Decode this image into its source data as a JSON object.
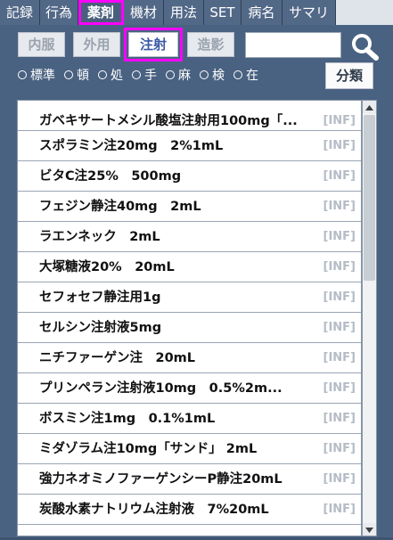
{
  "tabs": [
    {
      "label": "記録",
      "active": false
    },
    {
      "label": "行為",
      "active": false
    },
    {
      "label": "薬剤",
      "active": true
    },
    {
      "label": "機材",
      "active": false
    },
    {
      "label": "用法",
      "active": false
    },
    {
      "label": "SET",
      "active": false
    },
    {
      "label": "病名",
      "active": false
    },
    {
      "label": "サマリ",
      "active": false
    }
  ],
  "type_buttons": [
    {
      "label": "内服",
      "active": false
    },
    {
      "label": "外用",
      "active": false
    },
    {
      "label": "注射",
      "active": true
    },
    {
      "label": "造影",
      "active": false
    }
  ],
  "search": {
    "value": ""
  },
  "radios": [
    "標準",
    "頓",
    "処",
    "手",
    "麻",
    "検",
    "在"
  ],
  "classify_label": "分類",
  "drugs": [
    {
      "name": "ガベキサートメシル酸塩注射用100mg「...",
      "tag": "[INF]"
    },
    {
      "name": "スポラミン注20mg　2%1mL",
      "tag": "[INF]"
    },
    {
      "name": "ビタC注25%　500mg",
      "tag": "[INF]"
    },
    {
      "name": "フェジン静注40mg　2mL",
      "tag": "[INF]"
    },
    {
      "name": "ラエンネック　2mL",
      "tag": "[INF]"
    },
    {
      "name": "大塚糖液20%　20mL",
      "tag": "[INF]"
    },
    {
      "name": "セフォセフ静注用1g",
      "tag": "[INF]"
    },
    {
      "name": "セルシン注射液5mg",
      "tag": "[INF]"
    },
    {
      "name": "ニチファーゲン注　20mL",
      "tag": "[INF]"
    },
    {
      "name": "プリンペラン注射液10mg　0.5%2m...",
      "tag": "[INF]"
    },
    {
      "name": "ボスミン注1mg　0.1%1mL",
      "tag": "[INF]"
    },
    {
      "name": "ミダゾラム注10mg「サンド」 2mL",
      "tag": "[INF]"
    },
    {
      "name": "強力ネオミノファーゲンシーP静注20mL",
      "tag": "[INF]"
    },
    {
      "name": "炭酸水素ナトリウム注射液　7%20mL",
      "tag": "[INF]"
    }
  ]
}
